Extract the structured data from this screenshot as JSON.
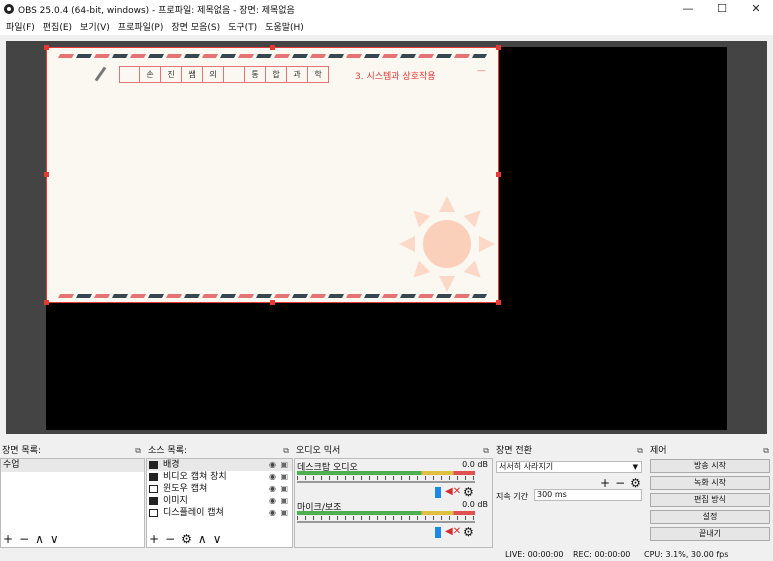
{
  "window": {
    "title": "OBS 25.0.4 (64-bit, windows) - 프로파일: 제목없음 - 장면: 제목없음",
    "minimize": "—",
    "maximize": "☐",
    "close": "✕"
  },
  "menu": [
    "파일(F)",
    "편집(E)",
    "보기(V)",
    "프로파일(P)",
    "장면 모음(S)",
    "도구(T)",
    "도움말(H)"
  ],
  "slide": {
    "words": [
      "",
      "손",
      "진",
      "쌤",
      "의",
      "",
      "통",
      "합",
      "과",
      "학"
    ],
    "subtitle": "3. 시스템과 상호작용",
    "dash": "—"
  },
  "scenes": {
    "title": "장면 목록:",
    "items": [
      "수업"
    ],
    "tools": [
      "+",
      "−",
      "∧",
      "∨"
    ]
  },
  "sources": {
    "title": "소스 목록:",
    "items": [
      "배경",
      "비디오 캡쳐 장치",
      "윈도우 캡쳐",
      "이미지",
      "디스플레이 캡쳐"
    ],
    "tools": [
      "+",
      "−",
      "⚙",
      "∧",
      "∨"
    ]
  },
  "mixer": {
    "title": "오디오 믹서",
    "channels": [
      {
        "name": "데스크탑 오디오",
        "db": "0.0 dB"
      },
      {
        "name": "마이크/보조",
        "db": "0.0 dB"
      }
    ]
  },
  "transitions": {
    "title": "장면 전환",
    "selected": "서서히 사라지기",
    "duration_label": "지속 기간",
    "duration_value": "300 ms",
    "tools": [
      "+",
      "−",
      "⚙"
    ]
  },
  "controls": {
    "title": "제어",
    "buttons": [
      "방송 시작",
      "녹화 시작",
      "편집 방식",
      "설정",
      "끝내기"
    ]
  },
  "status": {
    "live": "LIVE: 00:00:00",
    "rec": "REC: 00:00:00",
    "cpu": "CPU: 3.1%, 30.00 fps"
  }
}
